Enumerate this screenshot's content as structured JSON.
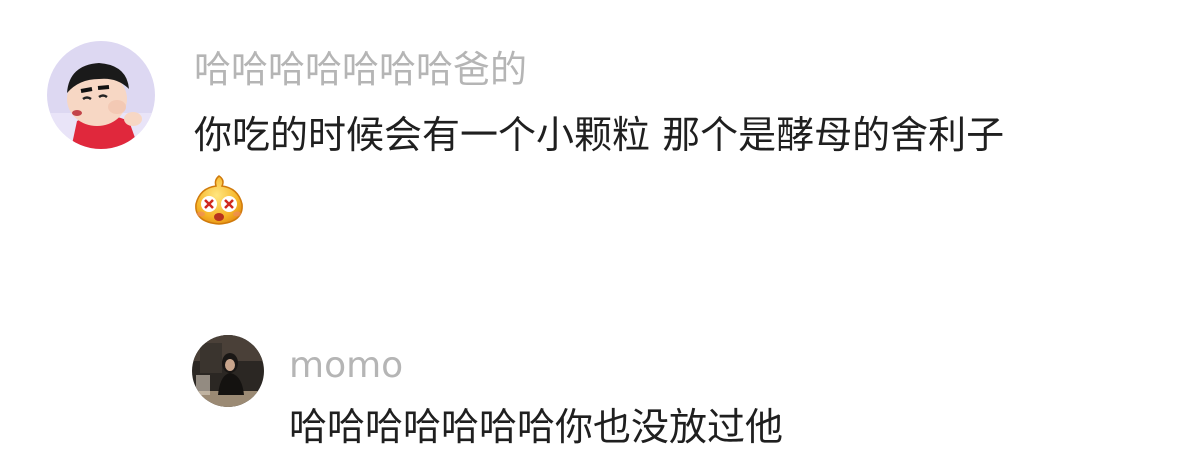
{
  "comments": [
    {
      "username": "哈哈哈哈哈哈哈爸的",
      "text": "你吃的时候会有一个小颗粒 那个是酵母的舍利子",
      "avatar_icon": "cartoon-boy-avatar-icon",
      "emoji_icon": "dizzy-face-emoji-icon"
    },
    {
      "username": "momo",
      "text": "哈哈哈哈哈哈哈你也没放过他",
      "avatar_icon": "photo-avatar-icon"
    }
  ],
  "colors": {
    "username": "#b5b5b5",
    "text": "#1f1f1f",
    "background": "#ffffff"
  }
}
